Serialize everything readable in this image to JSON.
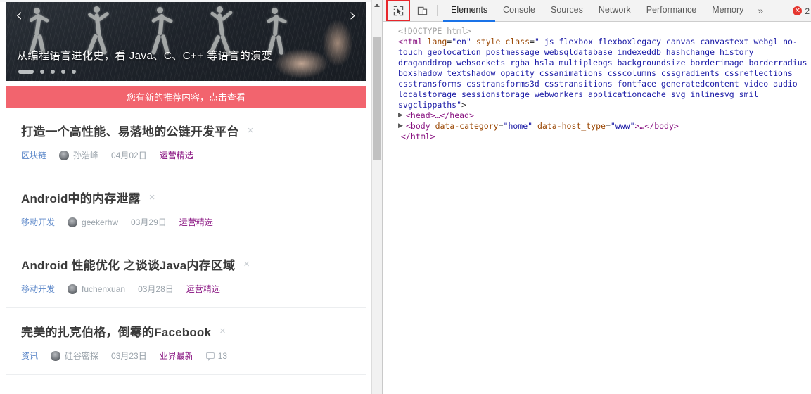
{
  "page": {
    "hero": {
      "title": "从编程语言进化史，看 Java、C、C++ 等语言的演变",
      "prev_arrow": "‹",
      "next_arrow": "›",
      "dots_total": 5,
      "active_dot": 1
    },
    "notice": {
      "text": "您有新的推荐内容，点击查看",
      "bg_color": "#f2646e"
    },
    "articles": [
      {
        "title": "打造一个高性能、易落地的公链开发平台",
        "close": "×",
        "category": "区块链",
        "author": "孙浩峰",
        "date": "04月02日",
        "tag": "运营精选",
        "comments": null
      },
      {
        "title": "Android中的内存泄露",
        "close": "×",
        "category": "移动开发",
        "author": "geekerhw",
        "date": "03月29日",
        "tag": "运营精选",
        "comments": null
      },
      {
        "title": "Android 性能优化 之谈谈Java内存区域",
        "close": "×",
        "category": "移动开发",
        "author": "fuchenxuan",
        "date": "03月28日",
        "tag": "运营精选",
        "comments": null
      },
      {
        "title": "完美的扎克伯格，倒霉的Facebook",
        "close": "×",
        "category": "资讯",
        "author": "硅谷密探",
        "date": "03月23日",
        "tag": "业界最新",
        "comments": "13"
      }
    ]
  },
  "devtools": {
    "toolbar": {
      "inspect_icon": "inspect-element-icon",
      "device_icon": "device-toolbar-icon",
      "more_tabs": "»",
      "error_count": "2",
      "error_badge_color": "#e5362f",
      "accent_color": "#1a73e8"
    },
    "tabs": [
      {
        "label": "Elements",
        "active": true
      },
      {
        "label": "Console",
        "active": false
      },
      {
        "label": "Sources",
        "active": false
      },
      {
        "label": "Network",
        "active": false
      },
      {
        "label": "Performance",
        "active": false
      },
      {
        "label": "Memory",
        "active": false
      }
    ],
    "dom": {
      "doctype": "<!DOCTYPE html>",
      "html_tag_open": "<html",
      "html_attr_lang_name": "lang",
      "html_attr_lang_value": "\"en\"",
      "html_attr_style": "style",
      "html_attr_class_name": "class",
      "html_attr_class_value": "\" js flexbox flexboxlegacy canvas canvastext webgl no-touch geolocation postmessage websqldatabase indexeddb hashchange history draganddrop websockets rgba hsla multiplebgs backgroundsize borderimage borderradius boxshadow textshadow opacity cssanimations csscolumns cssgradients cssreflections csstransforms csstransforms3d csstransitions fontface generatedcontent video audio localstorage sessionstorage webworkers applicationcache svg inlinesvg smil svgclippaths\"",
      "html_tag_close_bracket": ">",
      "head_node": "<head>…</head>",
      "body_tag_open": "<body",
      "body_attr1_name": "data-category",
      "body_attr1_value": "\"home\"",
      "body_attr2_name": "data-host_type",
      "body_attr2_value": "\"www\"",
      "body_tail": ">…</body>",
      "html_close": "</html>",
      "expand_triangle": "▶"
    }
  }
}
